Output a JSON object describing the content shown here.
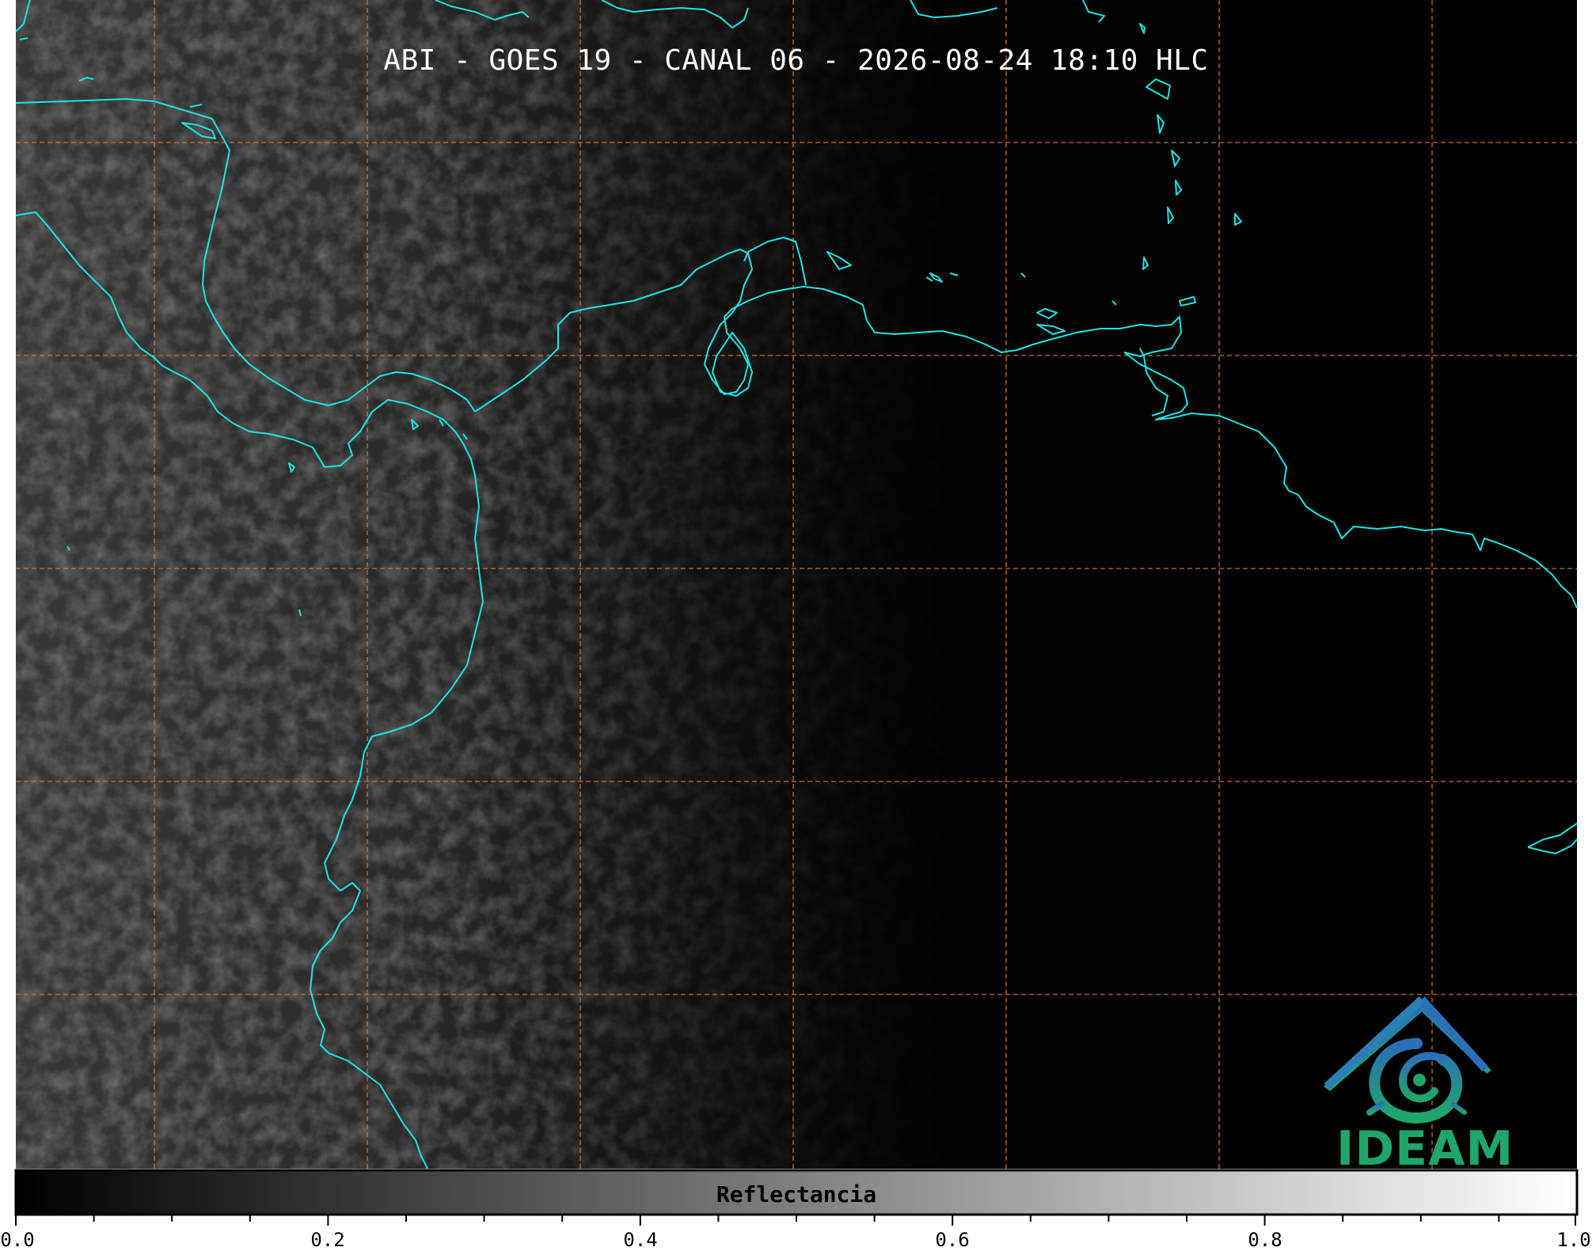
{
  "title": "ABI - GOES 19 - CANAL 06 - 2026-08-24 18:10 HLC",
  "colorbar": {
    "label": "Reflectancia",
    "ticks": [
      "0.0",
      "0.2",
      "0.4",
      "0.6",
      "0.8",
      "1.0"
    ],
    "range": [
      0.0,
      1.0
    ],
    "colormap": [
      "#000000",
      "#ffffff"
    ]
  },
  "logo": {
    "text": "IDEAM"
  },
  "colors": {
    "coastline": "#19e6e6",
    "gridlines": "#e0782c",
    "background": "#000000",
    "logo_blue": "#2a7fb8",
    "logo_green": "#1fa66a"
  }
}
